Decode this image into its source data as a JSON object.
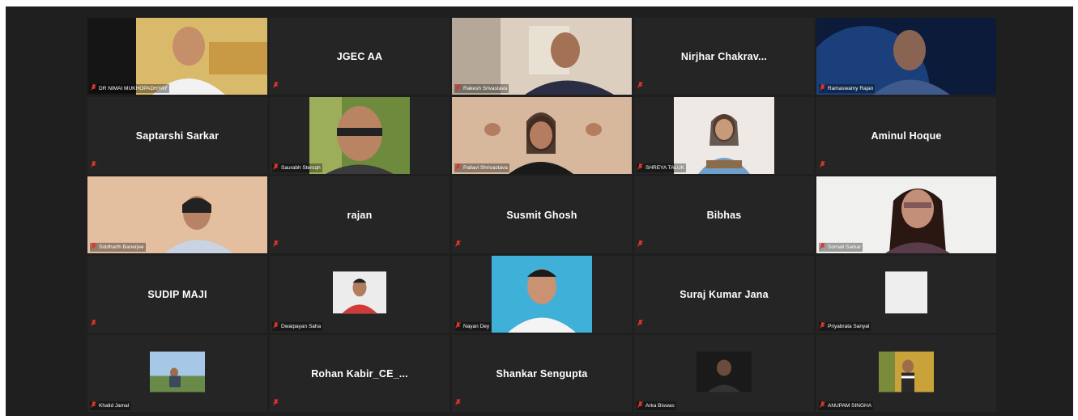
{
  "meeting": {
    "tiles": [
      {
        "name": "DR NIMAI MUKHOPADHYAY",
        "kind": "video",
        "scene": "office"
      },
      {
        "name": "JGEC AA",
        "kind": "name"
      },
      {
        "name": "Rakesh Srivastava",
        "kind": "video",
        "scene": "room"
      },
      {
        "name": "Nirjhar  Chakrav...",
        "kind": "name"
      },
      {
        "name": "Ramaswamy Rajan",
        "kind": "video",
        "scene": "space"
      },
      {
        "name": "Saptarshi Sarkar",
        "kind": "name"
      },
      {
        "name": "Saurabh Stercqh",
        "kind": "thumb",
        "scene": "man"
      },
      {
        "name": "Pallavi Shrivastava",
        "kind": "video",
        "scene": "woman",
        "active": true
      },
      {
        "name": "SHREYA TALUK",
        "kind": "thumb",
        "scene": "girl"
      },
      {
        "name": "Aminul Hoque",
        "kind": "name"
      },
      {
        "name": "Siddharth Banerjee",
        "kind": "video",
        "scene": "wall"
      },
      {
        "name": "rajan",
        "kind": "name"
      },
      {
        "name": "Susmit Ghosh",
        "kind": "name"
      },
      {
        "name": "Bibhas",
        "kind": "name"
      },
      {
        "name": "Sornali Sarkar",
        "kind": "video",
        "scene": "woman2"
      },
      {
        "name": "SUDIP MAJI",
        "kind": "name"
      },
      {
        "name": "Dwaipayan Saha",
        "kind": "thumb",
        "scene": "small-red"
      },
      {
        "name": "Nayan Dey",
        "kind": "thumb",
        "scene": "portrait"
      },
      {
        "name": "Suraj Kumar Jana",
        "kind": "name"
      },
      {
        "name": "Priyabrata Sanyal",
        "kind": "thumb",
        "scene": "blank"
      },
      {
        "name": "Khalid Jamal",
        "kind": "thumb",
        "scene": "field"
      },
      {
        "name": "Rohan  Kabir_CE_...",
        "kind": "name"
      },
      {
        "name": "Shankar Sengupta",
        "kind": "name"
      },
      {
        "name": "Arka Biswas",
        "kind": "thumb",
        "scene": "dark"
      },
      {
        "name": "ANUPAM SINGHA",
        "kind": "thumb",
        "scene": "yellow"
      }
    ]
  },
  "colors": {
    "window_bg": "#1f1f1f",
    "tile_bg": "#252525",
    "active_speaker": "#c7d63a",
    "muted_icon": "#e0332b"
  }
}
